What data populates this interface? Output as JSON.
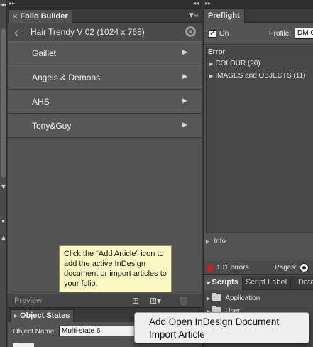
{
  "folio_panel": {
    "tab_label": "Folio Builder",
    "folio_title": "Hair Trendy V 02 (1024 x 768)",
    "articles": [
      {
        "name": "Gaillet"
      },
      {
        "name": "Angels & Demons"
      },
      {
        "name": "AHS"
      },
      {
        "name": "Tony&Guy"
      }
    ],
    "preview_label": "Preview"
  },
  "tooltip": {
    "text": "Click the “Add Article” icon to add the active InDesign document or import articles to your folio."
  },
  "object_states": {
    "tab_label": "Object States",
    "name_label": "Object Name:",
    "name_value": "Multi-state 6"
  },
  "preflight": {
    "tab_label": "Preflight",
    "on_label": "On",
    "profile_label": "Profile:",
    "profile_value": "DM C",
    "error_header": "Error",
    "errors": [
      {
        "label": "COLOUR (90)"
      },
      {
        "label": "IMAGES and OBJECTS (11)"
      }
    ],
    "info_label": "Info",
    "error_count": "101 errors",
    "pages_label": "Pages:"
  },
  "scripts_panel": {
    "tabs": [
      "Scripts",
      "Script Label",
      "Data"
    ],
    "folders": [
      "Application",
      "User"
    ]
  },
  "popup_menu": {
    "items": [
      "Add Open InDesign Document",
      "Import Article"
    ]
  },
  "colors": {
    "panel_bg": "#535353",
    "tooltip_bg": "#fdf9c3",
    "error_dot": "#d0201a",
    "menu_bg": "#f0f0f0"
  }
}
